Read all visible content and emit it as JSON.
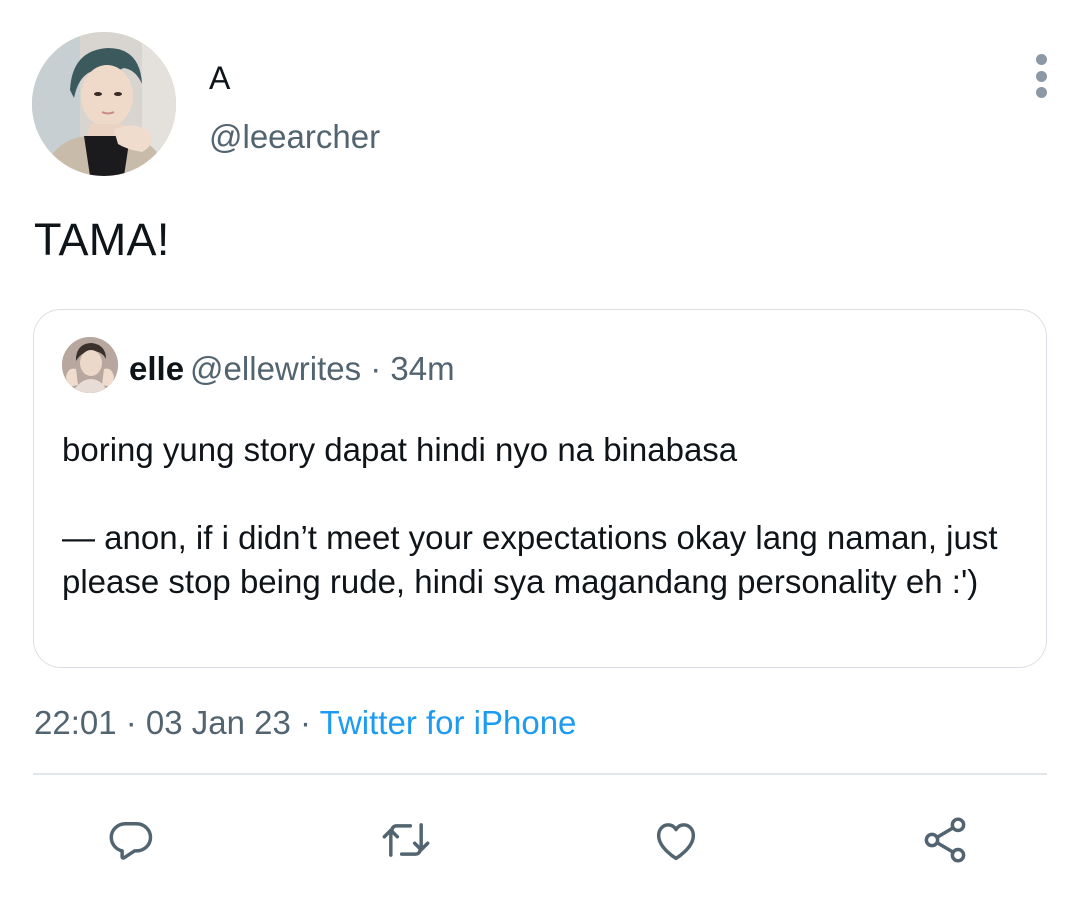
{
  "tweet": {
    "display_name": "A",
    "handle": "@leearcher",
    "text": "TAMA!",
    "more_icon": "more-vertical-icon"
  },
  "quoted": {
    "name": "elle",
    "meta": "@ellewrites · 34m",
    "paragraph_1": "boring yung story dapat hindi nyo na binabasa",
    "paragraph_2": "— anon, if i didn’t meet your expectations okay lang naman, just please stop being rude, hindi sya magandang personality eh :')"
  },
  "meta": {
    "time": "22:01",
    "separator": " · ",
    "date": "03 Jan 23",
    "source": "Twitter for iPhone"
  },
  "actions": {
    "reply": "reply-icon",
    "retweet": "retweet-icon",
    "like": "like-icon",
    "share": "share-icon"
  },
  "colors": {
    "text": "#0f1419",
    "secondary": "#536471",
    "link": "#1d9bf0",
    "border": "#d9dfe4",
    "icon": "#536471"
  }
}
